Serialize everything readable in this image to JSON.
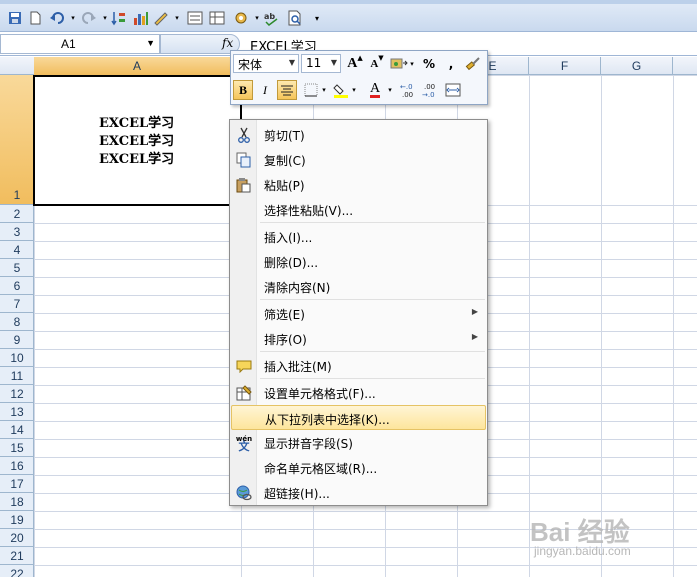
{
  "formula_bar": {
    "name_box": "A1",
    "fx_label": "fx",
    "content": "EXCEL学习"
  },
  "columns": [
    "A",
    "B",
    "C",
    "D",
    "E",
    "F",
    "G"
  ],
  "rows": [
    "1",
    "2",
    "3",
    "4",
    "5",
    "6",
    "7",
    "8",
    "9",
    "10",
    "11",
    "12",
    "13",
    "14",
    "15",
    "16",
    "17",
    "18",
    "19",
    "20",
    "21",
    "22"
  ],
  "active_cell": {
    "ref": "A1",
    "lines": [
      "EXCEL学习",
      "EXCEL学习",
      "EXCEL学习"
    ]
  },
  "mini_toolbar": {
    "font_name": "宋体",
    "font_size": "11",
    "grow_font": "A",
    "shrink_font": "A",
    "percent": "%",
    "comma": ",",
    "bold": "B",
    "italic": "I",
    "font_color_letter": "A",
    "inc_decimal": "←.0 .00",
    "dec_decimal": ".00 →.0"
  },
  "context_menu": {
    "items": [
      {
        "label": "剪切(T)",
        "icon": "scissors-icon"
      },
      {
        "label": "复制(C)",
        "icon": "copy-icon"
      },
      {
        "label": "粘贴(P)",
        "icon": "paste-icon"
      },
      {
        "label": "选择性粘贴(V)...",
        "icon": ""
      },
      {
        "label": "插入(I)...",
        "icon": ""
      },
      {
        "label": "删除(D)...",
        "icon": ""
      },
      {
        "label": "清除内容(N)",
        "icon": ""
      },
      {
        "label": "筛选(E)",
        "icon": "",
        "submenu": true
      },
      {
        "label": "排序(O)",
        "icon": "",
        "submenu": true
      },
      {
        "label": "插入批注(M)",
        "icon": "comment-icon"
      },
      {
        "label": "设置单元格格式(F)...",
        "icon": "format-cells-icon"
      },
      {
        "label": "从下拉列表中选择(K)...",
        "icon": "",
        "highlighted": true
      },
      {
        "label": "显示拼音字段(S)",
        "icon": "pinyin-icon"
      },
      {
        "label": "命名单元格区域(R)...",
        "icon": ""
      },
      {
        "label": "超链接(H)...",
        "icon": "hyperlink-icon"
      }
    ],
    "pinyin_icon_text": "wén"
  },
  "watermark": {
    "brand": "Bai 经验",
    "url": "jingyan.baidu.com"
  },
  "colors": {
    "selection_header": "#f6c55a",
    "menu_highlight": "#fde59c",
    "grid_line": "#d0d7e5",
    "font_color_red": "#e02020"
  }
}
